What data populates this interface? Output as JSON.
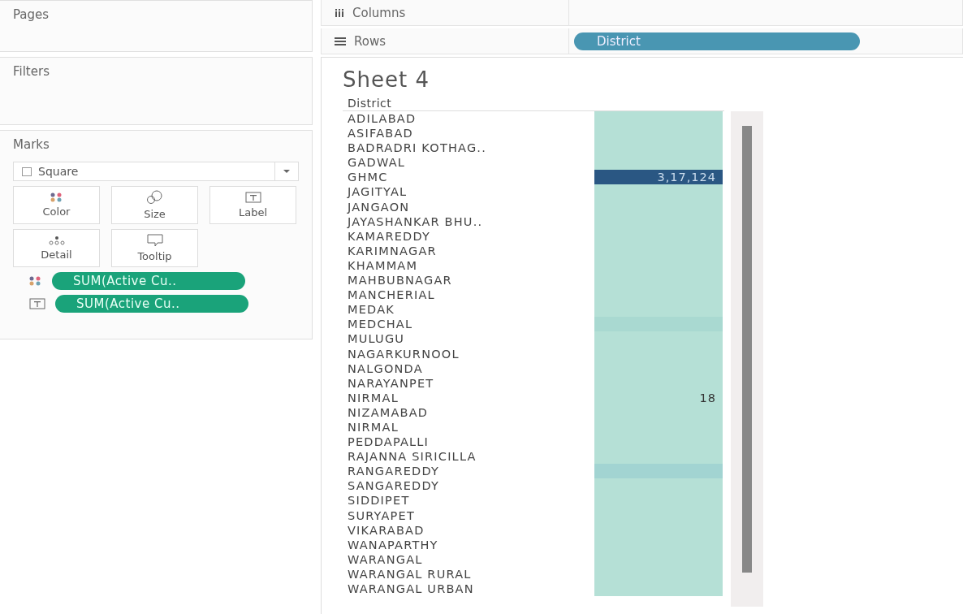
{
  "pages": {
    "title": "Pages"
  },
  "filters": {
    "title": "Filters"
  },
  "marks": {
    "title": "Marks",
    "mark_type": "Square",
    "cards": [
      {
        "kind": "color",
        "label": "Color"
      },
      {
        "kind": "size",
        "label": "Size"
      },
      {
        "kind": "label",
        "label": "Label"
      },
      {
        "kind": "detail",
        "label": "Detail"
      },
      {
        "kind": "tooltip",
        "label": "Tooltip"
      }
    ],
    "pills": [
      {
        "kind": "color",
        "label": "SUM(Active Cu.."
      },
      {
        "kind": "label",
        "label": "SUM(Active Cu.."
      }
    ]
  },
  "shelves": [
    {
      "kind": "columns",
      "label": "Columns"
    },
    {
      "kind": "rows",
      "label": "Rows",
      "pills": [
        "District"
      ]
    }
  ],
  "sheet": {
    "title": "Sheet 4",
    "header": "District",
    "rows": [
      {
        "name": "ADILABAD",
        "color": "#b5e0d6"
      },
      {
        "name": "ASIFABAD",
        "color": "#b5e0d6"
      },
      {
        "name": "BADRADRI KOTHAG..",
        "color": "#b5e0d6"
      },
      {
        "name": "GADWAL",
        "color": "#b5e0d6"
      },
      {
        "name": "GHMC",
        "color": "#2a5783",
        "value": "3,17,124"
      },
      {
        "name": "JAGITYAL",
        "color": "#b5e0d6"
      },
      {
        "name": "JANGAON",
        "color": "#b5e0d6"
      },
      {
        "name": "JAYASHANKAR BHU..",
        "color": "#b5e0d6"
      },
      {
        "name": "KAMAREDDY",
        "color": "#b5e0d6"
      },
      {
        "name": "KARIMNAGAR",
        "color": "#b5e0d6"
      },
      {
        "name": "KHAMMAM",
        "color": "#b5e0d6"
      },
      {
        "name": "MAHBUBNAGAR",
        "color": "#b5e0d6"
      },
      {
        "name": "MANCHERIAL",
        "color": "#b5e0d6"
      },
      {
        "name": "MEDAK",
        "color": "#b5e0d6"
      },
      {
        "name": "MEDCHAL",
        "color": "#a9d9d1"
      },
      {
        "name": "MULUGU",
        "color": "#b5e0d6"
      },
      {
        "name": "NAGARKURNOOL",
        "color": "#b5e0d6"
      },
      {
        "name": "NALGONDA",
        "color": "#b5e0d6"
      },
      {
        "name": "NARAYANPET",
        "color": "#b5e0d6"
      },
      {
        "name": "NIRMAL",
        "color": "#b5e0d6",
        "value": "18"
      },
      {
        "name": "NIZAMABAD",
        "color": "#b5e0d6"
      },
      {
        "name": "NIRMAL",
        "color": "#b5e0d6"
      },
      {
        "name": "PEDDAPALLI",
        "color": "#b5e0d6"
      },
      {
        "name": "RAJANNA SIRICILLA",
        "color": "#b5e0d6"
      },
      {
        "name": "RANGAREDDY",
        "color": "#a2d4d2"
      },
      {
        "name": "SANGAREDDY",
        "color": "#b5e0d6"
      },
      {
        "name": "SIDDIPET",
        "color": "#b5e0d6"
      },
      {
        "name": "SURYAPET",
        "color": "#b5e0d6"
      },
      {
        "name": "VIKARABAD",
        "color": "#b5e0d6"
      },
      {
        "name": "WANAPARTHY",
        "color": "#b5e0d6"
      },
      {
        "name": "WARANGAL",
        "color": "#b5e0d6"
      },
      {
        "name": "WARANGAL RURAL",
        "color": "#b5e0d6"
      },
      {
        "name": "WARANGAL URBAN",
        "color": "#b5e0d6"
      }
    ]
  }
}
